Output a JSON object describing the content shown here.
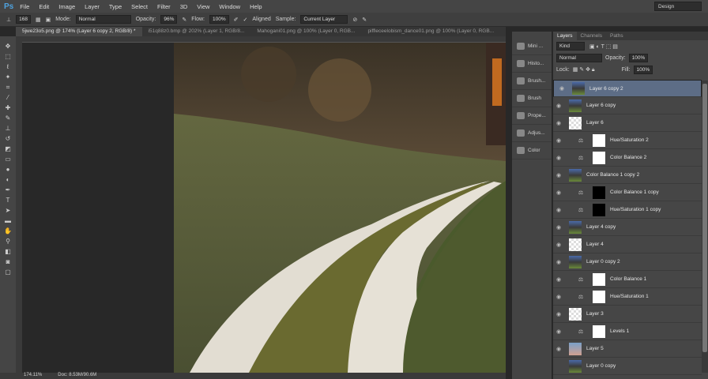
{
  "app": {
    "logo": "Ps",
    "menu": [
      "File",
      "Edit",
      "Image",
      "Layer",
      "Type",
      "Select",
      "Filter",
      "3D",
      "View",
      "Window",
      "Help"
    ],
    "workspace": "Design"
  },
  "options": {
    "brush_size": "168",
    "mode_label": "Mode:",
    "mode": "Normal",
    "opacity_label": "Opacity:",
    "opacity": "96%",
    "flow_label": "Flow:",
    "flow": "100%",
    "aligned": "Aligned",
    "sample_label": "Sample:",
    "sample": "Current Layer"
  },
  "tabs": [
    "5jwe23o5.png @ 174% (Layer 6 copy 2, RGB/8) *",
    "i51q88z0.bmp @ 202% (Layer 1, RGB/8...",
    "Mahogani01.png @ 100% (Layer 0, RGB...",
    "piffleceelobism_dance01.png @ 100% (Layer 0, RGB..."
  ],
  "status": {
    "zoom": "174.11%",
    "doc": "Doc: 8.53M/90.6M"
  },
  "dock": [
    "Mini ...",
    "Histo...",
    "Brush...",
    "Brush",
    "Prope...",
    "Adjus...",
    "Color"
  ],
  "layers_panel": {
    "tabs": [
      "Layers",
      "Channels",
      "Paths"
    ],
    "filter": "Kind",
    "blend": "Normal",
    "opacity_label": "Opacity:",
    "opacity": "100%",
    "lock_label": "Lock:",
    "fill_label": "Fill:",
    "fill": "100%",
    "layers": [
      {
        "name": "Layer 6 copy 2",
        "type": "img",
        "selected": true
      },
      {
        "name": "Layer 6 copy",
        "type": "img"
      },
      {
        "name": "Layer 6",
        "type": "trans"
      },
      {
        "name": "Hue/Saturation 2",
        "type": "adj"
      },
      {
        "name": "Color Balance 2",
        "type": "adj"
      },
      {
        "name": "Color Balance 1 copy 2",
        "type": "img"
      },
      {
        "name": "Color Balance 1 copy",
        "type": "adjb"
      },
      {
        "name": "Hue/Saturation 1 copy",
        "type": "adjb"
      },
      {
        "name": "Layer 4 copy",
        "type": "img"
      },
      {
        "name": "Layer 4",
        "type": "trans"
      },
      {
        "name": "Layer 0 copy 2",
        "type": "img"
      },
      {
        "name": "Color Balance 1",
        "type": "adj"
      },
      {
        "name": "Hue/Saturation 1",
        "type": "adj"
      },
      {
        "name": "Layer 3",
        "type": "trans"
      },
      {
        "name": "Levels 1",
        "type": "adj"
      },
      {
        "name": "Layer 5",
        "type": "sky"
      },
      {
        "name": "Layer 0 copy",
        "type": "img",
        "hidden": true
      }
    ]
  }
}
